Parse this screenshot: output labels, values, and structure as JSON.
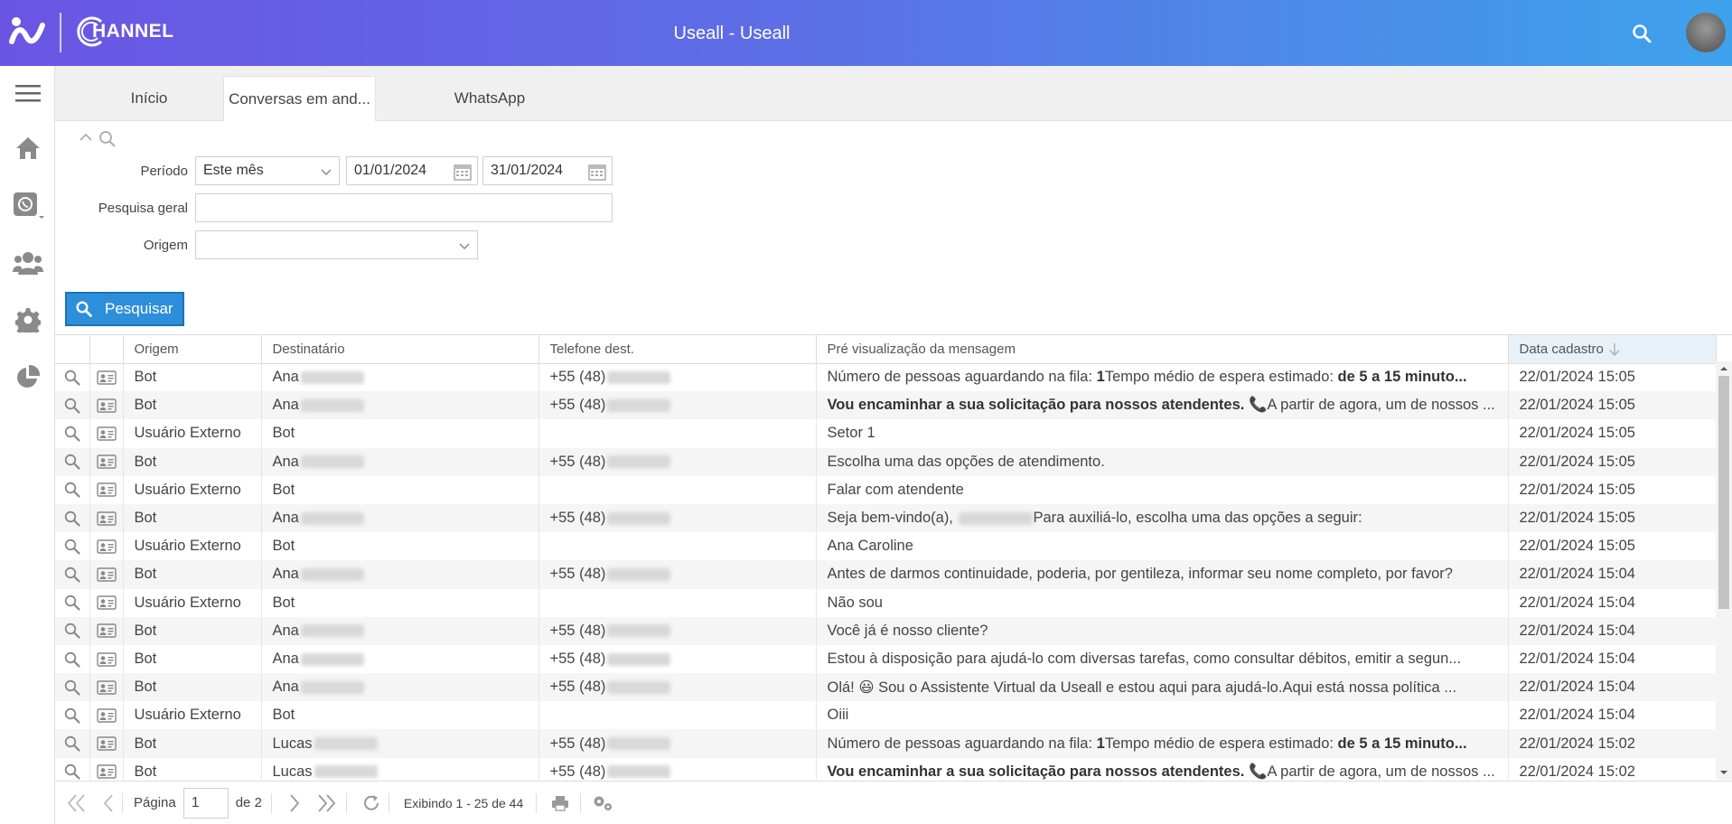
{
  "app": {
    "title": "Useall - Useall",
    "logo_text": "HANNEL"
  },
  "tabs": [
    {
      "label": "Início"
    },
    {
      "label": "Conversas em and..."
    },
    {
      "label": "WhatsApp"
    }
  ],
  "filters": {
    "periodo_label": "Período",
    "periodo_value": "Este mês",
    "date_from": "01/01/2024",
    "date_to": "31/01/2024",
    "pesquisa_label": "Pesquisa geral",
    "pesquisa_value": "",
    "origem_label": "Origem",
    "origem_value": "",
    "search_button": "Pesquisar"
  },
  "grid": {
    "columns": [
      "Origem",
      "Destinatário",
      "Telefone dest.",
      "Pré visualização da mensagem",
      "Data cadastro"
    ],
    "rows": [
      {
        "origem": "Bot",
        "dest": "Ana",
        "tel": "+55 (48)",
        "msg_a": "Número de pessoas aguardando na fila: ",
        "msg_b": "1",
        "msg_c": "Tempo médio de espera estimado: ",
        "msg_d": "de 5 a 15 minuto...",
        "date": "22/01/2024 15:05"
      },
      {
        "origem": "Bot",
        "dest": "Ana",
        "tel": "+55 (48)",
        "msg_a": "",
        "msg_b": "Vou encaminhar a sua solicitação para nossos atendentes.",
        "msg_c": " 📞A partir de agora, um de nossos ...",
        "msg_d": "",
        "date": "22/01/2024 15:05"
      },
      {
        "origem": "Usuário Externo",
        "dest": "Bot",
        "tel": "",
        "msg_a": "Setor 1",
        "msg_b": "",
        "msg_c": "",
        "msg_d": "",
        "date": "22/01/2024 15:05"
      },
      {
        "origem": "Bot",
        "dest": "Ana",
        "tel": "+55 (48)",
        "msg_a": "Escolha uma das opções de atendimento.",
        "msg_b": "",
        "msg_c": "",
        "msg_d": "",
        "date": "22/01/2024 15:05"
      },
      {
        "origem": "Usuário Externo",
        "dest": "Bot",
        "tel": "",
        "msg_a": "Falar com atendente",
        "msg_b": "",
        "msg_c": "",
        "msg_d": "",
        "date": "22/01/2024 15:05"
      },
      {
        "origem": "Bot",
        "dest": "Ana",
        "tel": "+55 (48)",
        "msg_a": "Seja bem-vindo(a), ",
        "msg_b": "",
        "msg_c": "Para auxiliá-lo, escolha uma das opções a seguir:",
        "msg_d": "",
        "date": "22/01/2024 15:05",
        "blur_msg": true
      },
      {
        "origem": "Usuário Externo",
        "dest": "Bot",
        "tel": "",
        "msg_a": "Ana Caroline",
        "msg_b": "",
        "msg_c": "",
        "msg_d": "",
        "date": "22/01/2024 15:05"
      },
      {
        "origem": "Bot",
        "dest": "Ana",
        "tel": "+55 (48)",
        "msg_a": "Antes de darmos continuidade, poderia, por gentileza, informar seu nome completo, por favor?",
        "msg_b": "",
        "msg_c": "",
        "msg_d": "",
        "date": "22/01/2024 15:04"
      },
      {
        "origem": "Usuário Externo",
        "dest": "Bot",
        "tel": "",
        "msg_a": "Não sou",
        "msg_b": "",
        "msg_c": "",
        "msg_d": "",
        "date": "22/01/2024 15:04"
      },
      {
        "origem": "Bot",
        "dest": "Ana",
        "tel": "+55 (48)",
        "msg_a": "Você já é nosso cliente?",
        "msg_b": "",
        "msg_c": "",
        "msg_d": "",
        "date": "22/01/2024 15:04"
      },
      {
        "origem": "Bot",
        "dest": "Ana",
        "tel": "+55 (48)",
        "msg_a": "Estou à disposição para ajudá-lo com diversas tarefas, como consultar débitos, emitir a segun...",
        "msg_b": "",
        "msg_c": "",
        "msg_d": "",
        "date": "22/01/2024 15:04"
      },
      {
        "origem": "Bot",
        "dest": "Ana",
        "tel": "+55 (48)",
        "msg_a": "Olá! 😃 Sou o Assistente Virtual da Useall e estou aqui para ajudá-lo.Aqui está nossa política ...",
        "msg_b": "",
        "msg_c": "",
        "msg_d": "",
        "date": "22/01/2024 15:04"
      },
      {
        "origem": "Usuário Externo",
        "dest": "Bot",
        "tel": "",
        "msg_a": "Oiii",
        "msg_b": "",
        "msg_c": "",
        "msg_d": "",
        "date": "22/01/2024 15:04"
      },
      {
        "origem": "Bot",
        "dest": "Lucas",
        "tel": "+55 (48)",
        "msg_a": "Número de pessoas aguardando na fila: ",
        "msg_b": "1",
        "msg_c": "Tempo médio de espera estimado: ",
        "msg_d": "de 5 a 15 minuto...",
        "date": "22/01/2024 15:02"
      },
      {
        "origem": "Bot",
        "dest": "Lucas",
        "tel": "+55 (48)",
        "msg_a": "",
        "msg_b": "Vou encaminhar a sua solicitação para nossos atendentes.",
        "msg_c": " 📞A partir de agora, um de nossos ...",
        "msg_d": "",
        "date": "22/01/2024 15:02"
      }
    ]
  },
  "pager": {
    "page_label": "Página",
    "page_value": "1",
    "of_label": "de 2",
    "showing": "Exibindo 1 - 25 de 44"
  },
  "colors": {
    "accent": "#2d8fd9",
    "header_start": "#6a55e3",
    "header_end": "#3ea2ec"
  }
}
